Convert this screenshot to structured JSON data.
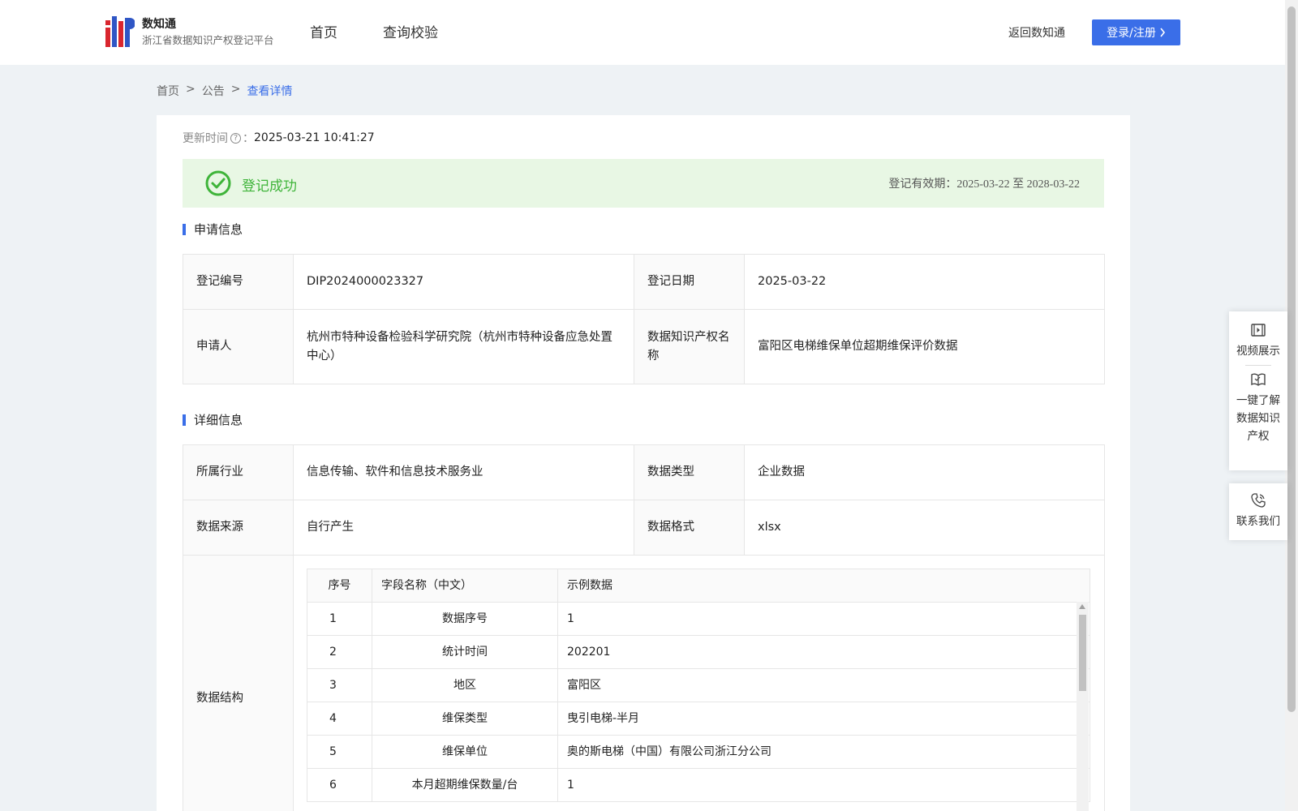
{
  "header": {
    "brand_name": "数知通",
    "brand_sub": "浙江省数据知识产权登记平台",
    "nav": [
      {
        "label": "首页"
      },
      {
        "label": "查询校验"
      }
    ],
    "back_link": "返回数知通",
    "login_label": "登录/注册",
    "accent": "#3a6ee8"
  },
  "breadcrumb": {
    "home": "首页",
    "sep1": ">",
    "section": "公告",
    "sep2": ">",
    "current": "查看详情"
  },
  "update": {
    "label": "更新时间",
    "colon": "：",
    "value": "2025-03-21 10:41:27"
  },
  "status": {
    "text": "登记成功",
    "valid_label": "登记有效期：",
    "valid_from": "2025-03-22",
    "valid_to_word": "至",
    "valid_to": "2028-03-22",
    "color": "#3fb43a"
  },
  "application": {
    "title": "申请信息",
    "rows": [
      {
        "l1": "登记编号",
        "v1": "DIP2024000023327",
        "l2": "登记日期",
        "v2": "2025-03-22"
      },
      {
        "l1": "申请人",
        "v1": "杭州市特种设备检验科学研究院（杭州市特种设备应急处置中心）",
        "l2": "数据知识产权名称",
        "v2": "富阳区电梯维保单位超期维保评价数据"
      }
    ]
  },
  "detail": {
    "title": "详细信息",
    "rows": [
      {
        "l1": "所属行业",
        "v1": "信息传输、软件和信息技术服务业",
        "l2": "数据类型",
        "v2": "企业数据"
      },
      {
        "l1": "数据来源",
        "v1": "自行产生",
        "l2": "数据格式",
        "v2": "xlsx"
      }
    ],
    "structure_label": "数据结构",
    "structure_headers": [
      "序号",
      "字段名称（中文）",
      "示例数据"
    ],
    "structure_rows": [
      {
        "idx": "1",
        "name": "数据序号",
        "example": "1"
      },
      {
        "idx": "2",
        "name": "统计时间",
        "example": "202201"
      },
      {
        "idx": "3",
        "name": "地区",
        "example": "富阳区"
      },
      {
        "idx": "4",
        "name": "维保类型",
        "example": "曳引电梯-半月"
      },
      {
        "idx": "5",
        "name": "维保单位",
        "example": "奥的斯电梯（中国）有限公司浙江分公司"
      },
      {
        "idx": "6",
        "name": "本月超期维保数量/台",
        "example": "1"
      }
    ]
  },
  "side": {
    "video": "视频展示",
    "learn": "一键了解数据知识产权",
    "contact": "联系我们",
    "video_icon": "video-icon",
    "learn_icon": "book-icon",
    "contact_icon": "phone-icon"
  }
}
